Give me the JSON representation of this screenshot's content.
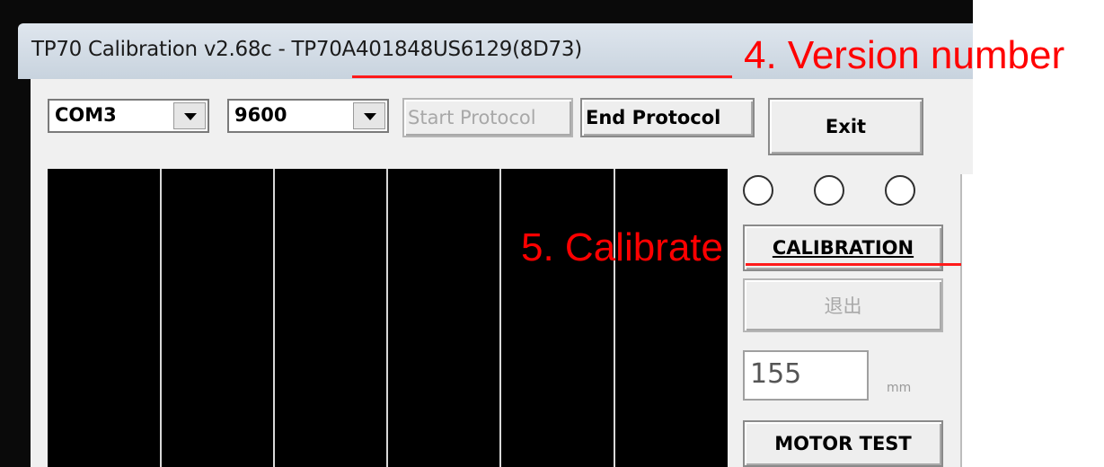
{
  "window": {
    "title": "TP70 Calibration v2.68c  - TP70A401848US6129(8D73)"
  },
  "toolbar": {
    "port_value": "COM3",
    "baud_value": "9600",
    "start_label": "Start Protocol",
    "end_label": "End Protocol",
    "exit_label": "Exit"
  },
  "controls": {
    "indicators": [
      "empty-circle",
      "empty-circle",
      "empty-circle"
    ],
    "calibration_label": "CALIBRATION",
    "quit_label": "退出",
    "distance_value": "155",
    "distance_unit": "mm",
    "motor_test_label": "MOTOR TEST"
  },
  "annotations": {
    "version": "4. Version number",
    "calibrate": "5. Calibrate",
    "color": "#ff0000"
  }
}
